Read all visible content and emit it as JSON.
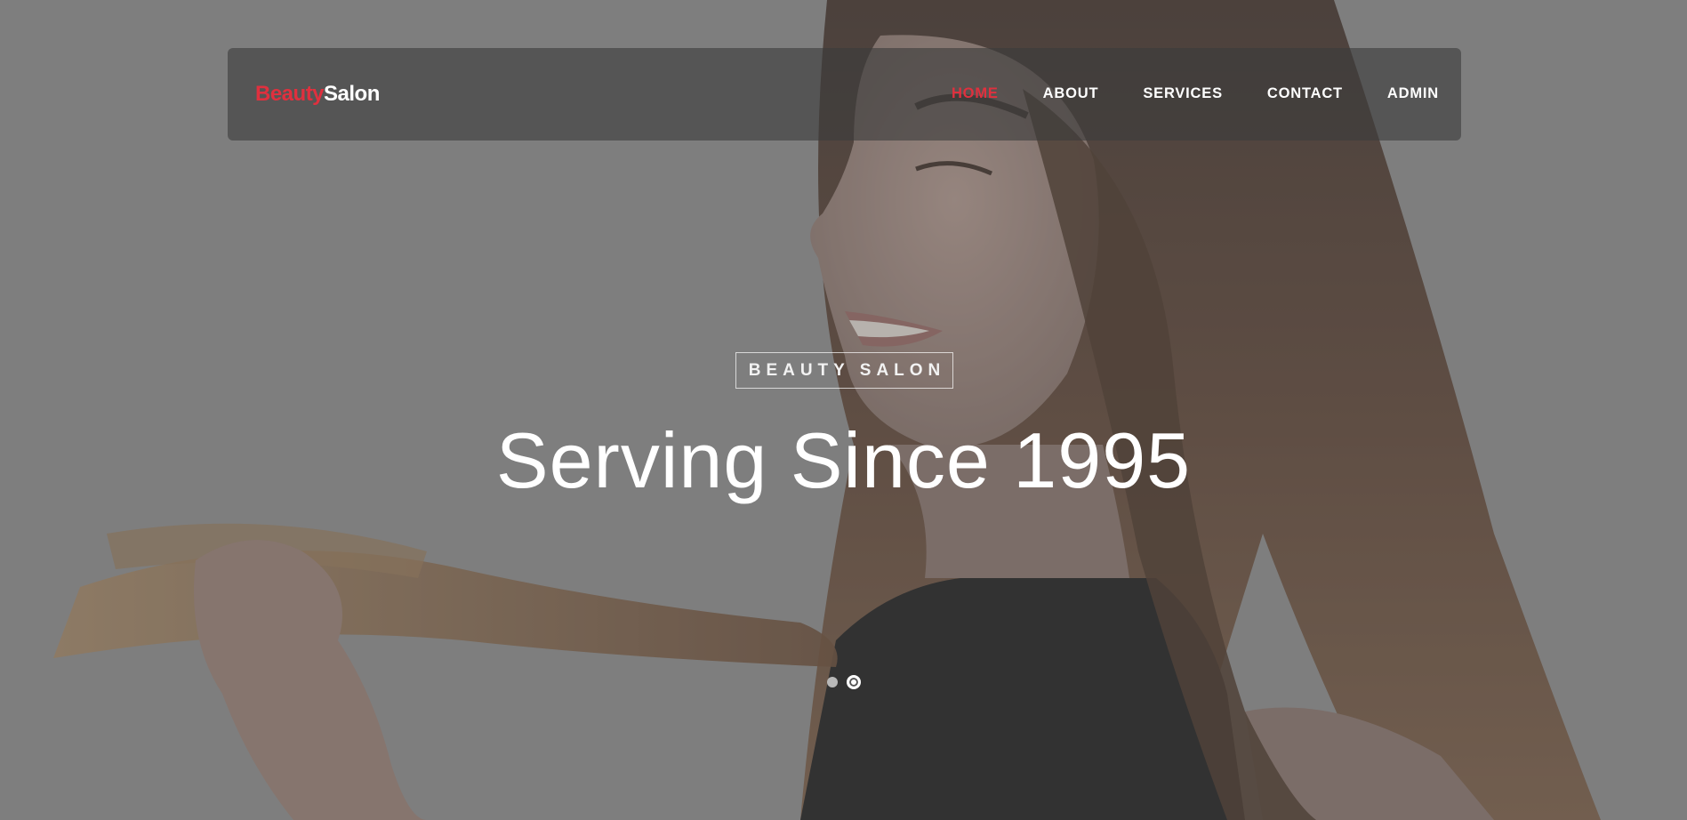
{
  "brand": {
    "part1": "Beauty",
    "part2": "Salon"
  },
  "nav": {
    "items": [
      {
        "label": "HOME",
        "active": true
      },
      {
        "label": "ABOUT",
        "active": false
      },
      {
        "label": "SERVICES",
        "active": false
      },
      {
        "label": "CONTACT",
        "active": false
      },
      {
        "label": "ADMIN",
        "active": false
      }
    ]
  },
  "hero": {
    "tagline": "BEAUTY SALON",
    "headline": "Serving Since 1995",
    "slides": 2,
    "active_slide": 2
  },
  "colors": {
    "accent": "#e0303e",
    "nav_bg": "#4a4a4a",
    "hero_bg": "#808080"
  }
}
